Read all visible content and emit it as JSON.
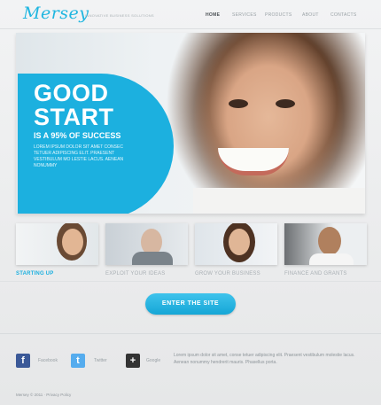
{
  "header": {
    "logo": "Mersey",
    "tagline": "INNOVATIVE BUSINESS SOLUTIONS",
    "nav": [
      "HOME",
      "SERVICES",
      "PRODUCTS",
      "ABOUT",
      "CONTACTS"
    ],
    "active_nav": "HOME"
  },
  "hero": {
    "title_line1": "GOOD",
    "title_line2": "START",
    "subtitle": "IS A 95% OF SUCCESS",
    "body": "LOREM IPSUM DOLOR SIT AMET CONSEC TETUER ADIPISCING ELIT. PRAESENT VESTIBULUM MO LESTIE LACUS. AENEAN NONUMMY"
  },
  "features": [
    {
      "label": "STARTING UP"
    },
    {
      "label": "EXPLOIT YOUR IDEAS"
    },
    {
      "label": "GROW YOUR BUSINESS"
    },
    {
      "label": "FINANCE AND GRANTS"
    }
  ],
  "cta": {
    "label": "ENTER THE SITE"
  },
  "social": [
    {
      "icon": "facebook-icon",
      "glyph": "f",
      "label": "Facebook",
      "color": "#3b5998"
    },
    {
      "icon": "twitter-icon",
      "glyph": "t",
      "label": "Twitter",
      "color": "#55acee"
    },
    {
      "icon": "google-plus-icon",
      "glyph": "+",
      "label": "Google",
      "color": "#333333"
    }
  ],
  "footer": {
    "text": "Lorem ipsum dolor sit amet, conse tetuer adipiscing elit. Praesent vestibulum molestie lacus. Aenean nonummy hendrerit mauris. Phasellus porta.",
    "copyright": "Mersey © 2011 · Privacy Policy"
  },
  "colors": {
    "accent": "#1cb0df",
    "background": "#e9eaeb"
  }
}
